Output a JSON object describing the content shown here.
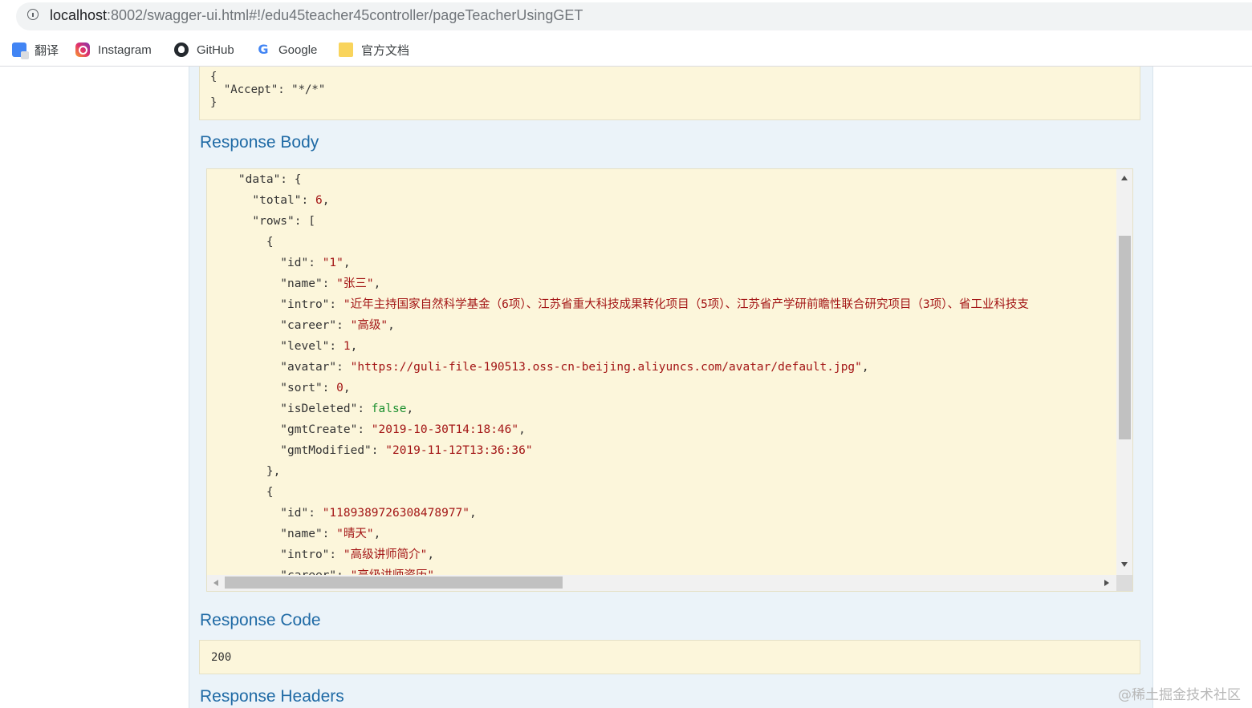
{
  "browser": {
    "url_host": "localhost",
    "url_rest": ":8002/swagger-ui.html#!/edu45teacher45controller/pageTeacherUsingGET",
    "bookmarks": [
      {
        "label": "翻译",
        "icon": "translate-icon"
      },
      {
        "label": "Instagram",
        "icon": "instagram-icon"
      },
      {
        "label": "GitHub",
        "icon": "github-icon"
      },
      {
        "label": "Google",
        "icon": "google-icon"
      },
      {
        "label": "官方文档",
        "icon": "folder-icon"
      }
    ]
  },
  "request_headers": {
    "lines": [
      "{",
      "  \"Accept\": \"*/*\"",
      "}"
    ]
  },
  "sections": {
    "response_body": "Response Body",
    "response_code": "Response Code",
    "response_headers": "Response Headers"
  },
  "response_body_lines": [
    [
      {
        "t": "k",
        "v": "    \"data\": {"
      }
    ],
    [
      {
        "t": "k",
        "v": "      \"total\": "
      },
      {
        "t": "n",
        "v": "6"
      },
      {
        "t": "k",
        "v": ","
      }
    ],
    [
      {
        "t": "k",
        "v": "      \"rows\": ["
      }
    ],
    [
      {
        "t": "k",
        "v": "        {"
      }
    ],
    [
      {
        "t": "k",
        "v": "          \"id\": "
      },
      {
        "t": "s",
        "v": "\"1\""
      },
      {
        "t": "k",
        "v": ","
      }
    ],
    [
      {
        "t": "k",
        "v": "          \"name\": "
      },
      {
        "t": "s",
        "v": "\"张三\""
      },
      {
        "t": "k",
        "v": ","
      }
    ],
    [
      {
        "t": "k",
        "v": "          \"intro\": "
      },
      {
        "t": "s",
        "v": "\"近年主持国家自然科学基金（6项）、江苏省重大科技成果转化项目（5项）、江苏省产学研前瞻性联合研究项目（3项）、省工业科技支"
      }
    ],
    [
      {
        "t": "k",
        "v": "          \"career\": "
      },
      {
        "t": "s",
        "v": "\"高级\""
      },
      {
        "t": "k",
        "v": ","
      }
    ],
    [
      {
        "t": "k",
        "v": "          \"level\": "
      },
      {
        "t": "n",
        "v": "1"
      },
      {
        "t": "k",
        "v": ","
      }
    ],
    [
      {
        "t": "k",
        "v": "          \"avatar\": "
      },
      {
        "t": "s",
        "v": "\"https://guli-file-190513.oss-cn-beijing.aliyuncs.com/avatar/default.jpg\""
      },
      {
        "t": "k",
        "v": ","
      }
    ],
    [
      {
        "t": "k",
        "v": "          \"sort\": "
      },
      {
        "t": "n",
        "v": "0"
      },
      {
        "t": "k",
        "v": ","
      }
    ],
    [
      {
        "t": "k",
        "v": "          \"isDeleted\": "
      },
      {
        "t": "b",
        "v": "false"
      },
      {
        "t": "k",
        "v": ","
      }
    ],
    [
      {
        "t": "k",
        "v": "          \"gmtCreate\": "
      },
      {
        "t": "s",
        "v": "\"2019-10-30T14:18:46\""
      },
      {
        "t": "k",
        "v": ","
      }
    ],
    [
      {
        "t": "k",
        "v": "          \"gmtModified\": "
      },
      {
        "t": "s",
        "v": "\"2019-11-12T13:36:36\""
      }
    ],
    [
      {
        "t": "k",
        "v": "        },"
      }
    ],
    [
      {
        "t": "k",
        "v": "        {"
      }
    ],
    [
      {
        "t": "k",
        "v": "          \"id\": "
      },
      {
        "t": "s",
        "v": "\"1189389726308478977\""
      },
      {
        "t": "k",
        "v": ","
      }
    ],
    [
      {
        "t": "k",
        "v": "          \"name\": "
      },
      {
        "t": "s",
        "v": "\"晴天\""
      },
      {
        "t": "k",
        "v": ","
      }
    ],
    [
      {
        "t": "k",
        "v": "          \"intro\": "
      },
      {
        "t": "s",
        "v": "\"高级讲师简介\""
      },
      {
        "t": "k",
        "v": ","
      }
    ],
    [
      {
        "t": "k",
        "v": "          \"career\": "
      },
      {
        "t": "s",
        "v": "\"高级讲师资历\""
      },
      {
        "t": "k",
        "v": ","
      }
    ]
  ],
  "response_code": "200",
  "watermark": "@稀土掘金技术社区",
  "colors": {
    "panel_bg": "#ebf3f9",
    "code_bg": "#fcf6db",
    "heading": "#1f6aa5",
    "string": "#a31515",
    "boolean": "#1a8f2e"
  }
}
